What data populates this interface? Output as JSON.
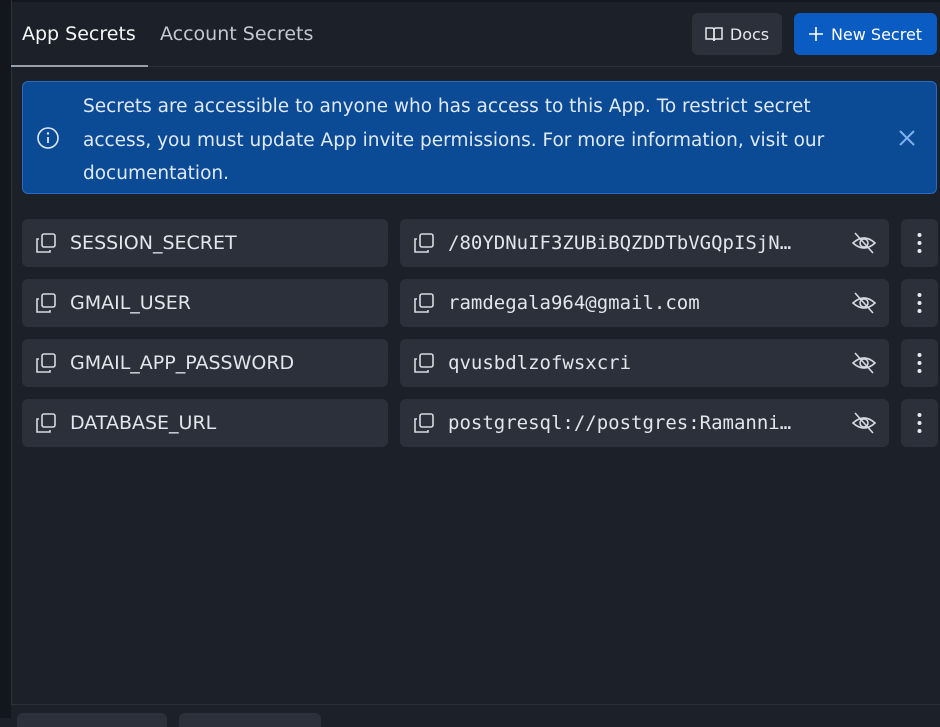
{
  "tabs": {
    "app_secrets": "App Secrets",
    "account_secrets": "Account Secrets"
  },
  "toolbar": {
    "docs_label": "Docs",
    "new_secret_label": "New Secret"
  },
  "banner": {
    "message": "Secrets are accessible to anyone who has access to this App. To restrict secret access, you must update App invite permissions. For more information, visit our documentation."
  },
  "secrets": [
    {
      "name": "SESSION_SECRET",
      "value": "/80YDNuIF3ZUBiBQZDDTbVGQpISjN…"
    },
    {
      "name": "GMAIL_USER",
      "value": "ramdegala964@gmail.com"
    },
    {
      "name": "GMAIL_APP_PASSWORD",
      "value": "qvusbdlzofwsxcri"
    },
    {
      "name": "DATABASE_URL",
      "value": "postgresql://postgres:Ramanni…"
    }
  ],
  "colors": {
    "background": "#1c2029",
    "surface": "#2b303b",
    "primary": "#0b5cc2",
    "banner": "#0b4a95"
  }
}
